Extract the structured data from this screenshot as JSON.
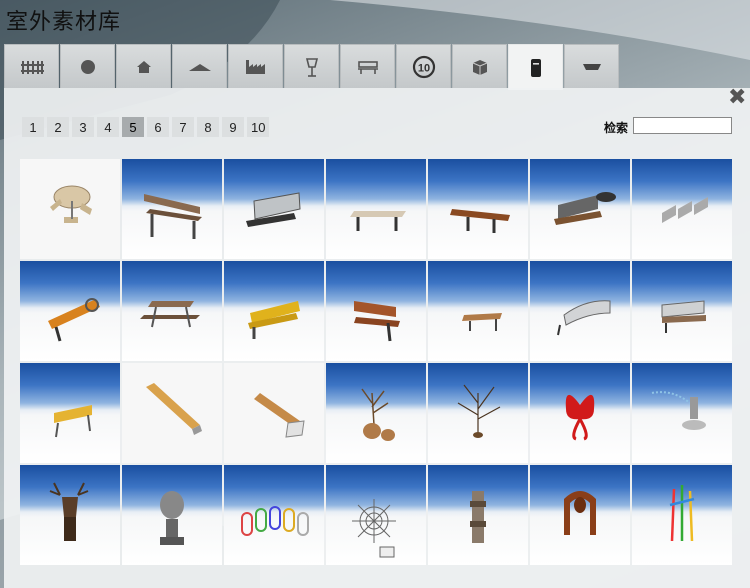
{
  "title": "室外素材库",
  "tabs": [
    {
      "name": "tab-fence",
      "icon": "fence-icon"
    },
    {
      "name": "tab-circle",
      "icon": "circle-icon"
    },
    {
      "name": "tab-house",
      "icon": "house-icon"
    },
    {
      "name": "tab-terrain",
      "icon": "terrain-icon"
    },
    {
      "name": "tab-factory",
      "icon": "factory-icon"
    },
    {
      "name": "tab-lamp",
      "icon": "lamp-icon"
    },
    {
      "name": "tab-bench",
      "icon": "bench-icon"
    },
    {
      "name": "tab-sign",
      "icon": "speed-sign-icon",
      "label": "10"
    },
    {
      "name": "tab-box",
      "icon": "box-icon"
    },
    {
      "name": "tab-bin",
      "icon": "trash-bin-icon",
      "active": true
    },
    {
      "name": "tab-planter",
      "icon": "planter-icon"
    }
  ],
  "pager": {
    "pages": [
      "1",
      "2",
      "3",
      "4",
      "5",
      "6",
      "7",
      "8",
      "9",
      "10"
    ],
    "current": "5"
  },
  "search": {
    "label": "检索",
    "value": ""
  },
  "thumbnails": [
    "round-picnic-table",
    "wood-bench-1",
    "metal-bench-1",
    "table-bench",
    "seesaw-bench",
    "scroll-bench",
    "triple-seat-bench",
    "orange-bench",
    "picnic-table",
    "yellow-bench",
    "wood-slat-bench",
    "flat-bench",
    "curved-metal-bench",
    "slat-bench-2",
    "yellow-bench-2",
    "concrete-wood-bench",
    "stone-wood-bench",
    "bare-tree-pots",
    "bare-tree",
    "butterfly-sculpture",
    "water-fountain-sculpture",
    "deer-head-sculpture",
    "head-sculpture",
    "paperclip-sculpture",
    "web-sculpture",
    "totem-sculpture",
    "arch-sculpture",
    "colorful-pole-sculpture"
  ]
}
